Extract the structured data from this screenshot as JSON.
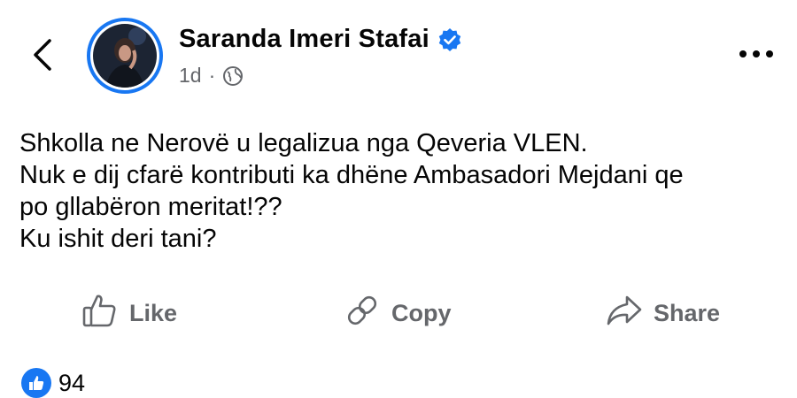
{
  "header": {
    "author_name": "Saranda Imeri Stafai",
    "time_ago": "1d",
    "separator": "·"
  },
  "post": {
    "lines": [
      "Shkolla ne Nerovë u legalizua nga Qeveria VLEN.",
      "Nuk e dij cfarë kontributi ka dhëne Ambasadori Mejdani qe",
      "po gllabëron meritat!??",
      "Ku ishit deri tani?"
    ]
  },
  "actions": {
    "like_label": "Like",
    "copy_label": "Copy",
    "share_label": "Share"
  },
  "reactions": {
    "count": "94"
  },
  "icons": {
    "back": "chevron-left-icon",
    "verified": "verified-badge-icon",
    "privacy": "globe-icon",
    "more": "more-options-icon",
    "like": "thumbs-up-icon",
    "copy": "link-icon",
    "share": "share-arrow-icon"
  },
  "colors": {
    "accent": "#1877f2",
    "secondary_text": "#65676b",
    "primary_text": "#050505"
  }
}
